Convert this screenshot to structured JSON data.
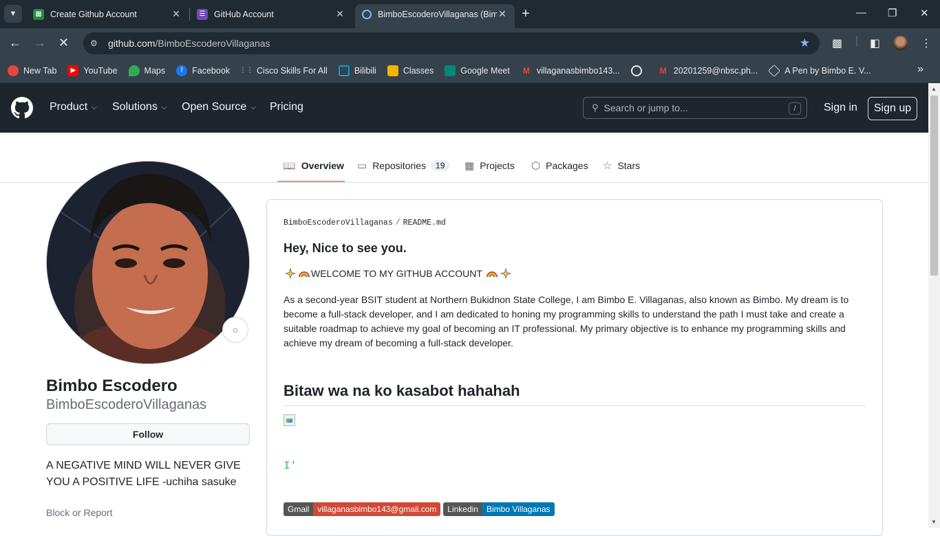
{
  "browser": {
    "tabs": [
      {
        "title": "Create Github Account",
        "favicon": "sheets-icon",
        "color": "#1e8e3e"
      },
      {
        "title": "GitHub Account",
        "favicon": "forms-icon",
        "color": "#7248b9"
      },
      {
        "title": "BimboEscoderoVillaganas (Bimb",
        "favicon": "github-icon",
        "color": "#8ab4f8"
      }
    ],
    "url_domain": "github.com",
    "url_path": "/BimboEscoderoVillaganas",
    "bookmarks": [
      {
        "label": "New Tab",
        "icon": "chrome-icon",
        "color": "#e8453c"
      },
      {
        "label": "YouTube",
        "icon": "youtube-icon",
        "color": "#ff0000"
      },
      {
        "label": "Maps",
        "icon": "maps-icon",
        "color": "#34a853"
      },
      {
        "label": "Facebook",
        "icon": "facebook-icon",
        "color": "#1877f2"
      },
      {
        "label": "Cisco Skills For All",
        "icon": "cisco-icon",
        "color": "#9aa0a6"
      },
      {
        "label": "Bilibili",
        "icon": "bilibili-icon",
        "color": "#00a1d6"
      },
      {
        "label": "Classes",
        "icon": "classroom-icon",
        "color": "#f4b400"
      },
      {
        "label": "Google Meet",
        "icon": "meet-icon",
        "color": "#00897b"
      },
      {
        "label": "villaganasbimbo143...",
        "icon": "gmail-icon",
        "color": "#ea4335"
      },
      {
        "label": "",
        "icon": "globe-icon",
        "color": "#9aa0a6"
      },
      {
        "label": "20201259@nbsc.ph...",
        "icon": "gmail-icon",
        "color": "#ea4335"
      },
      {
        "label": "A Pen by Bimbo E. V...",
        "icon": "codepen-icon",
        "color": "#e8eaed"
      }
    ]
  },
  "github": {
    "nav": [
      "Product",
      "Solutions",
      "Open Source",
      "Pricing"
    ],
    "search_placeholder": "Search or jump to...",
    "search_shortcut": "/",
    "signin": "Sign in",
    "signup": "Sign up"
  },
  "profile_tabs": [
    {
      "label": "Overview",
      "icon": "book-icon"
    },
    {
      "label": "Repositories",
      "icon": "repo-icon",
      "count": "19"
    },
    {
      "label": "Projects",
      "icon": "table-icon"
    },
    {
      "label": "Packages",
      "icon": "package-icon"
    },
    {
      "label": "Stars",
      "icon": "star-icon"
    }
  ],
  "profile": {
    "name": "Bimbo Escodero",
    "login": "BimboEscoderoVillaganas",
    "follow": "Follow",
    "bio": "A NEGATIVE MIND WILL NEVER GIVE YOU A POSITIVE LIFE -uchiha sasuke",
    "block_report": "Block or Report"
  },
  "readme": {
    "owner": "BimboEscoderoVillaganas",
    "sep": "/",
    "file": "README.md",
    "greeting": "Hey, Nice to see you.",
    "welcome": "WELCOME TO MY GITHUB ACCOUNT",
    "paragraph": "As a second-year BSIT student at Northern Bukidnon State College, I am Bimbo E. Villaganas, also known as Bimbo. My dream is to become a full-stack developer, and I am dedicated to honing my programming skills to understand the path I must take and create a suitable roadmap to achieve my goal of becoming an IT professional. My primary objective is to enhance my programming skills and achieve my dream of becoming a full-stack developer.",
    "heading2": "Bitaw wa na ko kasabot hahahah",
    "typing_text": "I'",
    "badges": [
      {
        "label": "Gmail",
        "value": "villaganasbimbo143@gmail.com",
        "color": "#d14836"
      },
      {
        "label": "Linkedin",
        "value": "Bimbo Villaganas",
        "color": "#0077b5"
      }
    ]
  }
}
